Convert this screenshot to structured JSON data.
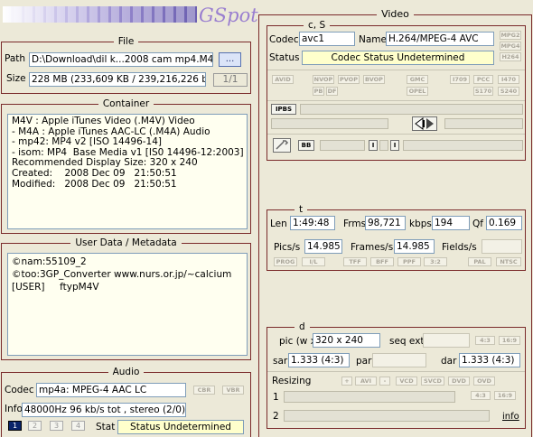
{
  "logo": {
    "text": "GSpot"
  },
  "file": {
    "title": "File",
    "path_label": "Path",
    "path_value": "D:\\Download\\dil k...2008 cam  mp4.M4V",
    "browse_label": "...",
    "size_label": "Size",
    "size_value": "228 MB (233,609 KB / 239,216,226 byte",
    "count": "1/1"
  },
  "container": {
    "title": "Container",
    "lines": [
      "M4V : Apple iTunes Video (.M4V) Video",
      "- M4A : Apple iTunes AAC-LC (.M4A) Audio",
      "- mp42: MP4 v2 [ISO 14496-14]",
      "- isom: MP4  Base Media v1 [IS0 14496-12:2003]",
      "Recommended Display Size: 320 x 240",
      "Created:    2008 Dec 09   21:50:51",
      "Modified:   2008 Dec 09   21:50:51"
    ]
  },
  "metadata": {
    "title": "User Data / Metadata",
    "lines": [
      "©nam:55109_2",
      "©too:3GP_Converter www.nurs.or.jp/~calcium",
      "[USER]     ftypM4V"
    ]
  },
  "audio": {
    "title": "Audio",
    "codec_label": "Codec",
    "codec_value": "mp4a: MPEG-4 AAC LC",
    "cbr": "CBR",
    "vbr": "VBR",
    "info_label": "Info",
    "info_value": "48000Hz  96 kb/s tot , stereo (2/0)",
    "tracks": [
      "1",
      "2",
      "3",
      "4"
    ],
    "stat_label": "Stat",
    "stat_value": "Status Undetermined"
  },
  "video": {
    "title": "Video",
    "cs_title": "c, S",
    "codec_label": "Codec",
    "codec_value": "avc1",
    "name_label": "Name",
    "name_value": "H.264/MPEG-4 AVC",
    "mpeg_tags": [
      "MPG2",
      "MPG4",
      "H264"
    ],
    "status_label": "Status",
    "status_value": "Codec Status Undetermined",
    "flags_a": [
      "AVID"
    ],
    "flags_b": [
      "NVOP",
      "PVOP",
      "BVOP"
    ],
    "flags_c": [
      "PB",
      "DF"
    ],
    "flags_d": [
      "GMC",
      "OPEL"
    ],
    "flags_e": [
      "I709",
      "PCC",
      "I470",
      "S170",
      "S240"
    ],
    "ipbs": "IPBS",
    "bb": "BB",
    "i_left": "I",
    "i_right": "I",
    "t_title": "t",
    "len_label": "Len",
    "len_value": "1:49:48",
    "frms_label": "Frms",
    "frms_value": "98,721",
    "kbps_label": "kbps",
    "kbps_value": "194",
    "qf_label": "Qf",
    "qf_value": "0.169",
    "pics_label": "Pics/s",
    "pics_value": "14.985",
    "frames_label": "Frames/s",
    "frames_value": "14.985",
    "fields_label": "Fields/s",
    "scan_flags": [
      "PROG",
      "I/L",
      "TFF",
      "BFF",
      "PPF",
      "3:2",
      "PAL",
      "NTSC"
    ],
    "d_title": "d",
    "pic_label": "pic (w x",
    "pic_value": "320 x 240",
    "seqext_label": "seq ext",
    "ar_a": "4:3",
    "ar_b": "16:9",
    "sar_label": "sar",
    "sar_value": "1.333 (4:3)",
    "par_label": "par",
    "dar_label": "dar",
    "dar_value": "1.333 (4:3)",
    "resizing_label": "Resizing",
    "resize_plus": "+",
    "resize_avi": "AVI",
    "resize_minus": "-",
    "resize_vcd": "VCD",
    "resize_svcd": "SVCD",
    "resize_dvd": "DVD",
    "resize_ovd": "OVD",
    "row1": "1",
    "row2": "2",
    "ar_c": "4:3",
    "ar_d": "16:9",
    "info_link": "info"
  },
  "colors": {
    "accent": "#7a2a2a",
    "logo": "#9a7fd0",
    "field_yellow": "#ffffcc"
  }
}
